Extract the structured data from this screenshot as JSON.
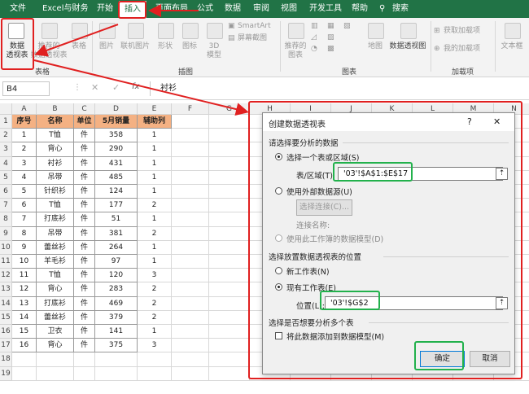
{
  "menu": {
    "items": [
      "文件",
      "Excel与财务",
      "开始",
      "插入",
      "页面布局",
      "公式",
      "数据",
      "审阅",
      "视图",
      "开发工具",
      "帮助",
      "搜索"
    ],
    "active_index": 3
  },
  "ribbon": {
    "pivot_table_label_1": "数据",
    "pivot_table_label_2": "透视表",
    "recommended_pivot_1": "推荐的",
    "recommended_pivot_2": "数据透视表",
    "table_label": "表格",
    "picture_label": "图片",
    "online_picture_label": "联机图片",
    "shapes_label": "形状",
    "icons_label": "图标",
    "model3d_1": "3D",
    "model3d_2": "模型",
    "smartart_label": "SmartArt",
    "screenshot_label": "屏幕截图",
    "recommended_charts_1": "推荐的",
    "recommended_charts_2": "图表",
    "map_label": "地图",
    "pivot_chart_label": "数据透视图",
    "get_addins_label": "获取加载项",
    "my_addins_label": "我的加载项",
    "textbox_label": "文本框",
    "group_tables": "表格",
    "group_illustrations": "插图",
    "group_charts": "图表",
    "group_addins": "加载项"
  },
  "formula_bar": {
    "name_box": "B4",
    "fx": "fx",
    "value": "衬衫"
  },
  "columns": [
    "A",
    "B",
    "C",
    "D",
    "E",
    "F",
    "G",
    "H",
    "I",
    "J",
    "K",
    "L",
    "M",
    "N"
  ],
  "rows": [
    "1",
    "2",
    "3",
    "4",
    "5",
    "6",
    "7",
    "8",
    "9",
    "10",
    "11",
    "12",
    "13",
    "14",
    "15",
    "16",
    "17",
    "18",
    "19"
  ],
  "table": {
    "headers": [
      "序号",
      "名称",
      "单位",
      "5月销量",
      "辅助列"
    ],
    "rows": [
      [
        "1",
        "T恤",
        "件",
        "358",
        "1"
      ],
      [
        "2",
        "背心",
        "件",
        "290",
        "1"
      ],
      [
        "3",
        "衬衫",
        "件",
        "431",
        "1"
      ],
      [
        "4",
        "吊带",
        "件",
        "485",
        "1"
      ],
      [
        "5",
        "针织衫",
        "件",
        "124",
        "1"
      ],
      [
        "6",
        "T恤",
        "件",
        "177",
        "2"
      ],
      [
        "7",
        "打底衫",
        "件",
        "51",
        "1"
      ],
      [
        "8",
        "吊带",
        "件",
        "381",
        "2"
      ],
      [
        "9",
        "蕾丝衫",
        "件",
        "264",
        "1"
      ],
      [
        "10",
        "羊毛衫",
        "件",
        "97",
        "1"
      ],
      [
        "11",
        "T恤",
        "件",
        "120",
        "3"
      ],
      [
        "12",
        "背心",
        "件",
        "283",
        "2"
      ],
      [
        "13",
        "打底衫",
        "件",
        "469",
        "2"
      ],
      [
        "14",
        "蕾丝衫",
        "件",
        "379",
        "2"
      ],
      [
        "15",
        "卫衣",
        "件",
        "141",
        "1"
      ],
      [
        "16",
        "背心",
        "件",
        "375",
        "3"
      ]
    ]
  },
  "dialog": {
    "title": "创建数据透视表",
    "help": "?",
    "close": "✕",
    "section1": "请选择要分析的数据",
    "opt_select_range": "选择一个表或区域(S)",
    "range_label": "表/区域(T):",
    "range_value": "'03'!$A$1:$E$17",
    "opt_external": "使用外部数据源(U)",
    "choose_conn_btn": "选择连接(C)...",
    "conn_name_label": "连接名称:",
    "opt_data_model": "使用此工作簿的数据模型(D)",
    "section2": "选择放置数据透视表的位置",
    "opt_new_sheet": "新工作表(N)",
    "opt_existing_sheet": "现有工作表(E)",
    "location_label": "位置(L):",
    "location_value": "'03'!$G$2",
    "section3": "选择是否想要分析多个表",
    "add_to_model": "将此数据添加到数据模型(M)",
    "ok": "确定",
    "cancel": "取消"
  },
  "colors": {
    "excel_green": "#217346",
    "header_fill": "#f4b183",
    "annotation_red": "#e02020",
    "annotation_green": "#22b14c"
  }
}
